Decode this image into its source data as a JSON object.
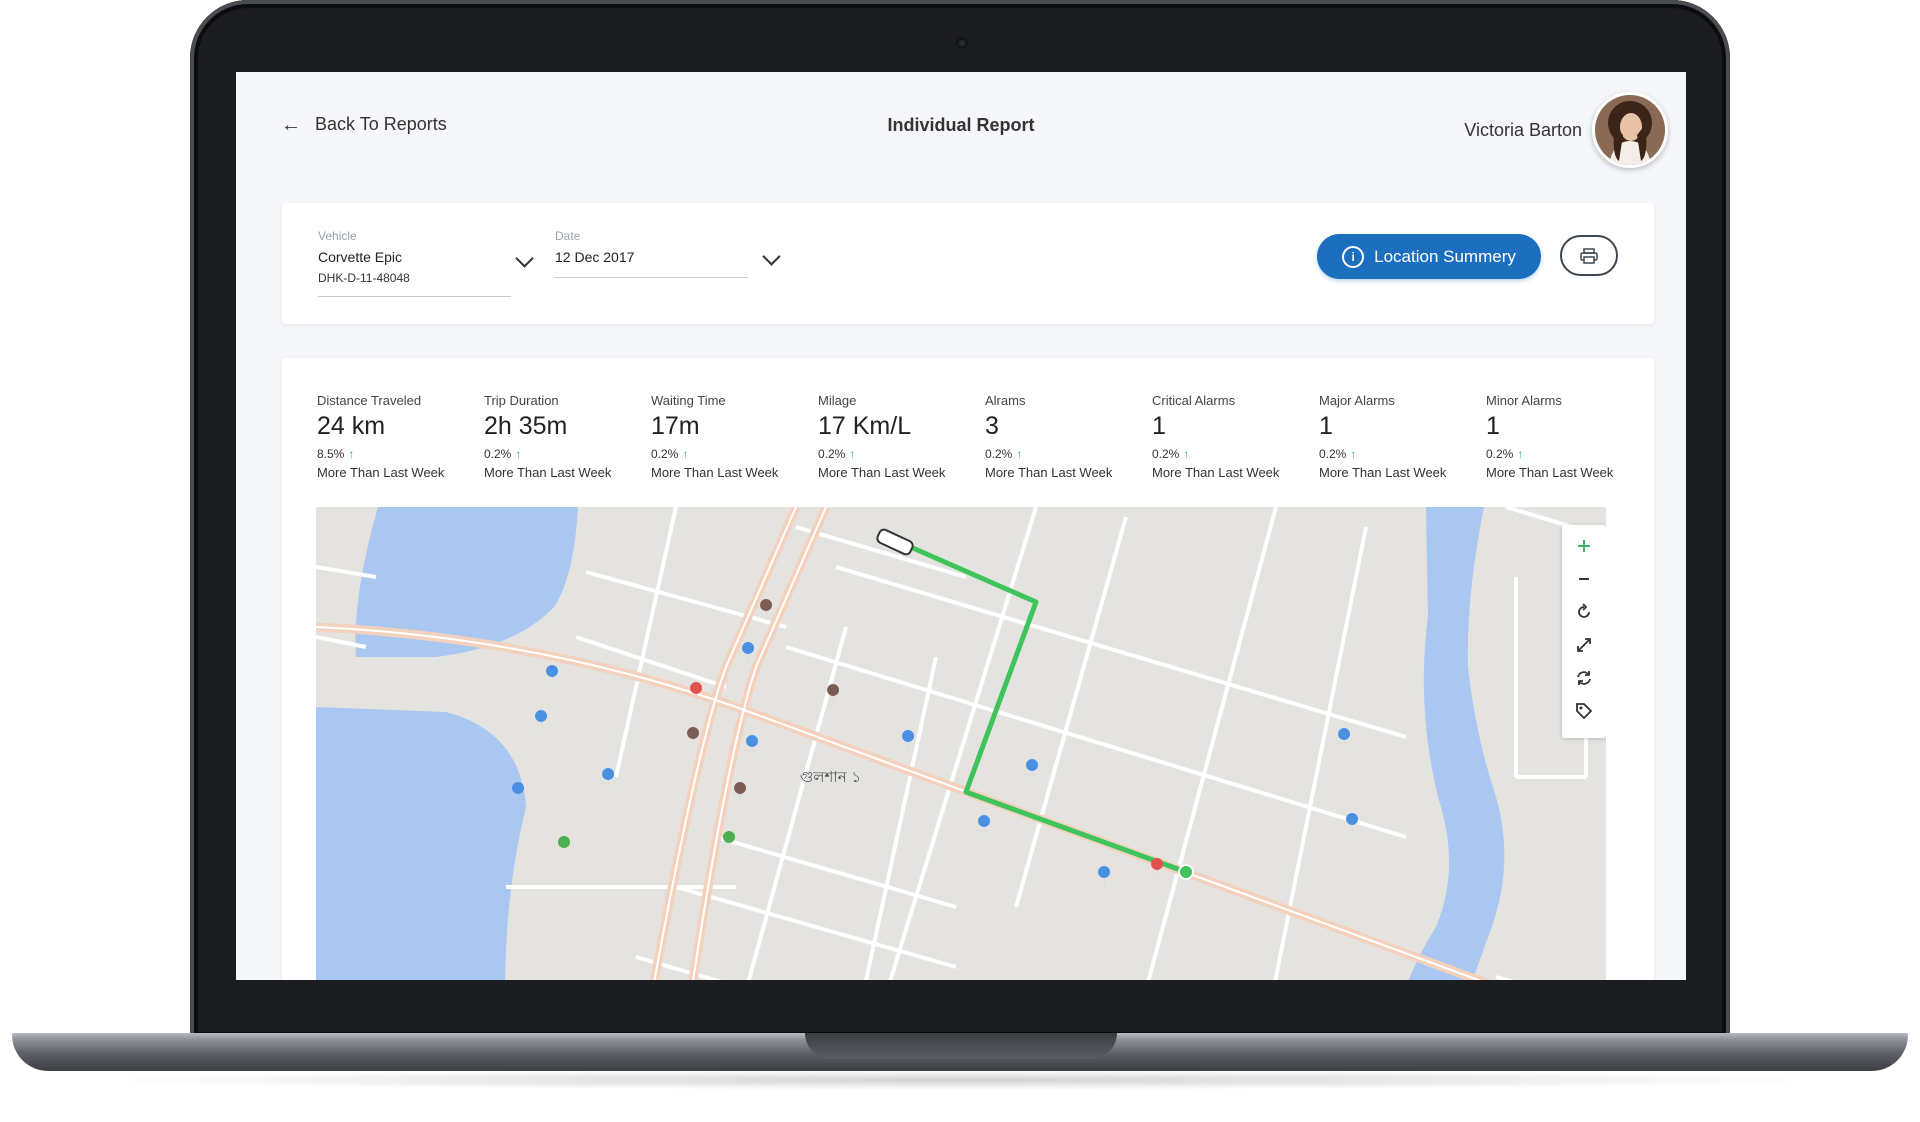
{
  "header": {
    "back_label": "Back To Reports",
    "title": "Individual Report",
    "user_name": "Victoria Barton"
  },
  "filters": {
    "vehicle_label": "Vehicle",
    "vehicle_name": "Corvette Epic",
    "vehicle_plate": "DHK-D-11-48048",
    "date_label": "Date",
    "date_value": "12 Dec 2017"
  },
  "actions": {
    "location_summary": "Location Summery",
    "print_icon": "printer-icon"
  },
  "stats": [
    {
      "label": "Distance Traveled",
      "value": "24 km",
      "change": "8.5%",
      "note": "More Than Last Week"
    },
    {
      "label": "Trip Duration",
      "value": "2h 35m",
      "change": "0.2%",
      "note": "More Than Last Week"
    },
    {
      "label": "Waiting Time",
      "value": "17m",
      "change": "0.2%",
      "note": "More Than Last Week"
    },
    {
      "label": "Milage",
      "value": "17 Km/L",
      "change": "0.2%",
      "note": "More Than Last Week"
    },
    {
      "label": "Alrams",
      "value": "3",
      "change": "0.2%",
      "note": "More Than Last Week"
    },
    {
      "label": "Critical Alarms",
      "value": "1",
      "change": "0.2%",
      "note": "More Than Last Week"
    },
    {
      "label": "Major Alarms",
      "value": "1",
      "change": "0.2%",
      "note": "More Than Last Week"
    },
    {
      "label": "Minor Alarms",
      "value": "1",
      "change": "0.2%",
      "note": "More Than Last Week"
    }
  ],
  "map": {
    "area_label": "গুলশান ১",
    "controls": [
      "zoom-in-icon",
      "zoom-out-icon",
      "rotate-icon",
      "fullscreen-icon",
      "refresh-icon",
      "tag-icon"
    ],
    "route_color": "#3ec45a"
  },
  "colors": {
    "accent": "#1b6fbe",
    "positive": "#3db36a",
    "water": "#a9c7f1",
    "land": "#e5e3e0"
  }
}
